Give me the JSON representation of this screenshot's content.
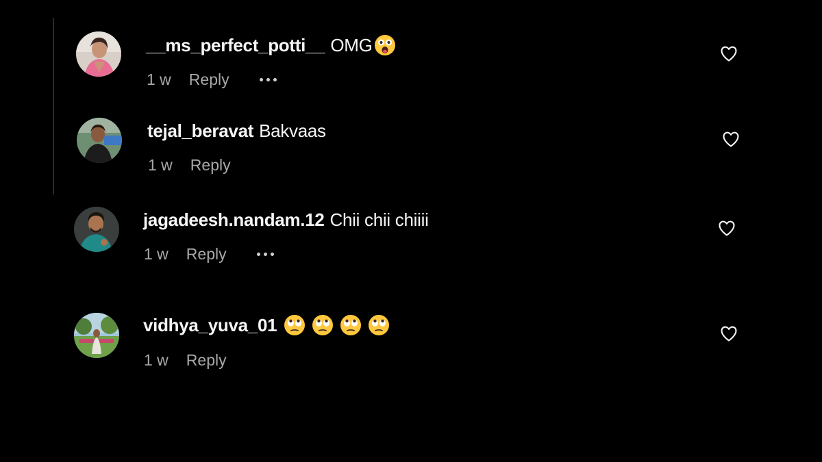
{
  "colors": {
    "background": "#000000",
    "text": "#f5f5f5",
    "meta": "#a8a8a8",
    "thread_line": "#2a2a2a"
  },
  "comments": [
    {
      "username": "__ms_perfect_potti__",
      "text": "OMG",
      "emoji": "astonished-face-emoji",
      "time": "1 w",
      "reply": "Reply",
      "has_more": true,
      "avatar": "user-avatar-woman-pink",
      "like_icon": "heart-outline-icon"
    },
    {
      "username": "tejal_beravat",
      "text": "Bakvaas",
      "time": "1 w",
      "reply": "Reply",
      "has_more": false,
      "avatar": "user-avatar-woman-outdoor",
      "like_icon": "heart-outline-icon"
    },
    {
      "username": "jagadeesh.nandam.12",
      "text": "Chii chii chiiii",
      "time": "1 w",
      "reply": "Reply",
      "has_more": true,
      "avatar": "user-avatar-man-teal",
      "like_icon": "heart-outline-icon"
    },
    {
      "username": "vidhya_yuva_01",
      "text": "",
      "emoji": "face-with-rolling-eyes-emoji",
      "emoji_count": 4,
      "time": "1 w",
      "reply": "Reply",
      "has_more": false,
      "avatar": "user-avatar-garden",
      "like_icon": "heart-outline-icon"
    }
  ]
}
